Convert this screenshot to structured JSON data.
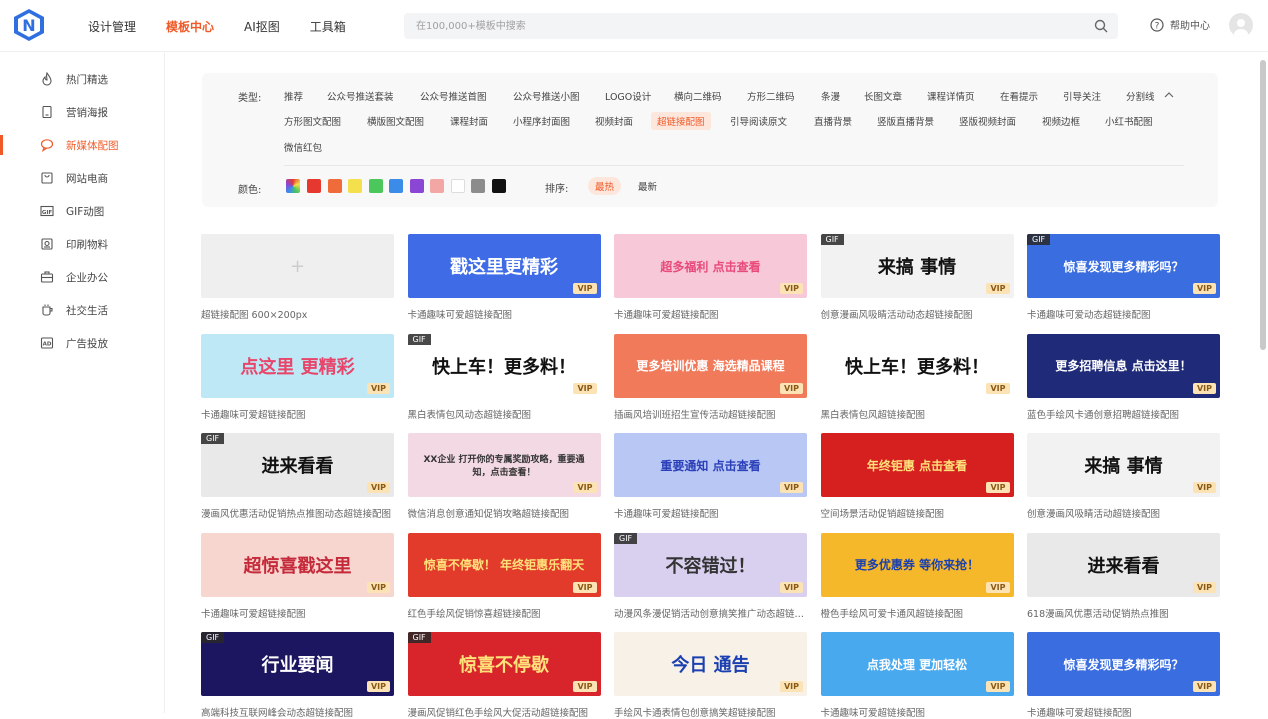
{
  "nav": {
    "items": [
      "设计管理",
      "模板中心",
      "AI抠图",
      "工具箱"
    ],
    "active_index": 1
  },
  "search": {
    "placeholder": "在100,000+模板中搜索"
  },
  "help": {
    "label": "帮助中心"
  },
  "sidebar": {
    "items": [
      {
        "label": "热门精选",
        "icon": "flame-icon"
      },
      {
        "label": "营销海报",
        "icon": "poster-icon"
      },
      {
        "label": "新媒体配图",
        "icon": "chat-icon"
      },
      {
        "label": "网站电商",
        "icon": "shop-icon"
      },
      {
        "label": "GIF动图",
        "icon": "gif-icon"
      },
      {
        "label": "印刷物料",
        "icon": "print-icon"
      },
      {
        "label": "企业办公",
        "icon": "briefcase-icon"
      },
      {
        "label": "社交生活",
        "icon": "cup-icon"
      },
      {
        "label": "广告投放",
        "icon": "ad-icon"
      }
    ],
    "active_index": 2
  },
  "filter": {
    "type_label": "类型:",
    "types_row1": [
      "推荐",
      "公众号推送套装",
      "公众号推送首图",
      "公众号推送小图",
      "LOGO设计",
      "横向二维码",
      "方形二维码",
      "条漫",
      "长图文章",
      "课程详情页",
      "在看提示",
      "引导关注",
      "分割线"
    ],
    "types_row2": [
      "方形图文配图",
      "横版图文配图",
      "课程封面",
      "小程序封面图",
      "视频封面",
      "超链接配图",
      "引导阅读原文",
      "直播背景",
      "竖版直播背景",
      "竖版视频封面",
      "视频边框",
      "小红书配图"
    ],
    "types_row3": [
      "微信红包"
    ],
    "active_type": "超链接配图",
    "color_label": "颜色:",
    "colors": [
      "#e6382f",
      "#ef6b39",
      "#f4e04d",
      "#4cc75b",
      "#3b8ce8",
      "#8b46d4",
      "#f2a7a4",
      "#ffffff",
      "#8c8c8c",
      "#111111"
    ],
    "sort_label": "排序:",
    "sort_options": [
      "最热",
      "最新"
    ],
    "active_sort": "最热"
  },
  "cards": [
    {
      "caption": "超链接配图 600×200px",
      "bg": "#efefef",
      "text": "",
      "fg": "#ccc",
      "gif": false,
      "vip": false,
      "plus": true
    },
    {
      "caption": "卡通趣味可爱超链接配图",
      "bg": "#3f6ce6",
      "text": "戳这里更精彩",
      "fg": "#fff",
      "gif": false,
      "vip": true
    },
    {
      "caption": "卡通趣味可爱超链接配图",
      "bg": "#f7c8d8",
      "text": "超多福利 点击查看",
      "fg": "#e84a7a",
      "gif": false,
      "vip": true
    },
    {
      "caption": "创意漫画风吸睛活动动态超链接配图",
      "bg": "#f2f2f2",
      "text": "来搞 事情",
      "fg": "#111",
      "gif": true,
      "vip": true
    },
    {
      "caption": "卡通趣味可爱动态超链接配图",
      "bg": "#3a6de0",
      "text": "惊喜发现更多精彩吗？",
      "fg": "#fff",
      "gif": true,
      "vip": true
    },
    {
      "caption": "卡通趣味可爱超链接配图",
      "bg": "#bfe8f7",
      "text": "点这里 更精彩",
      "fg": "#e8456a",
      "gif": false,
      "vip": true
    },
    {
      "caption": "黑白表情包风动态超链接配图",
      "bg": "#ffffff",
      "text": "快上车！更多料！",
      "fg": "#111",
      "gif": true,
      "vip": true
    },
    {
      "caption": "插画风培训班招生宣传活动超链接配图",
      "bg": "#f07a5a",
      "text": "更多培训优惠 海选精品课程",
      "fg": "#fff",
      "gif": false,
      "vip": true
    },
    {
      "caption": "黑白表情包风超链接配图",
      "bg": "#ffffff",
      "text": "快上车！更多料！",
      "fg": "#111",
      "gif": false,
      "vip": true
    },
    {
      "caption": "蓝色手绘风卡通创意招聘超链接配图",
      "bg": "#1f2a78",
      "text": "更多招聘信息 点击这里！",
      "fg": "#fff",
      "gif": false,
      "vip": true
    },
    {
      "caption": "漫画风优惠活动促销热点推图动态超链接配图",
      "bg": "#e9e9e9",
      "text": "进来看看",
      "fg": "#111",
      "gif": true,
      "vip": true
    },
    {
      "caption": "微信消息创意通知促销攻略超链接配图",
      "bg": "#f3d9e3",
      "text": "XX企业 打开你的专属奖励攻略，重要通知，点击查看！",
      "fg": "#333",
      "gif": false,
      "vip": true
    },
    {
      "caption": "卡通趣味可爱超链接配图",
      "bg": "#b9c7f5",
      "text": "重要通知 点击查看",
      "fg": "#2a3fb8",
      "gif": false,
      "vip": true
    },
    {
      "caption": "空间场景活动促销超链接配图",
      "bg": "#d61f1f",
      "text": "年终钜惠 点击查看",
      "fg": "#ffe27a",
      "gif": false,
      "vip": true
    },
    {
      "caption": "创意漫画风吸睛活动超链接配图",
      "bg": "#f2f2f2",
      "text": "来搞 事情",
      "fg": "#111",
      "gif": false,
      "vip": true
    },
    {
      "caption": "卡通趣味可爱超链接配图",
      "bg": "#f8d6d0",
      "text": "超惊喜戳这里",
      "fg": "#c42a3a",
      "gif": false,
      "vip": true
    },
    {
      "caption": "红色手绘风促销惊喜超链接配图",
      "bg": "#e23b2b",
      "text": "惊喜不停歇！ 年终钜惠乐翻天",
      "fg": "#ffe27a",
      "gif": false,
      "vip": true
    },
    {
      "caption": "动漫风条漫促销活动创意搞笑推广动态超链接配图",
      "bg": "#d9d0ef",
      "text": "不容错过！",
      "fg": "#333",
      "gif": true,
      "vip": true
    },
    {
      "caption": "橙色手绘风可爱卡通风超链接配图",
      "bg": "#f5b82a",
      "text": "更多优惠券 等你来抢！",
      "fg": "#1a3fb0",
      "gif": false,
      "vip": true
    },
    {
      "caption": "618漫画风优惠活动促销热点推图",
      "bg": "#e9e9e9",
      "text": "进来看看",
      "fg": "#111",
      "gif": false,
      "vip": true
    },
    {
      "caption": "高端科技互联网峰会动态超链接配图",
      "bg": "#1c1560",
      "text": "行业要闻",
      "fg": "#fff",
      "gif": true,
      "vip": true
    },
    {
      "caption": "漫画风促销红色手绘风大促活动超链接配图",
      "bg": "#d8252c",
      "text": "惊喜不停歇",
      "fg": "#ffe27a",
      "gif": true,
      "vip": true
    },
    {
      "caption": "手绘风卡通表情包创意搞笑超链接配图",
      "bg": "#f7f1e8",
      "text": "今日 通告",
      "fg": "#1a3fb0",
      "gif": false,
      "vip": true
    },
    {
      "caption": "卡通趣味可爱超链接配图",
      "bg": "#49a9ef",
      "text": "点我处理 更加轻松",
      "fg": "#fff",
      "gif": false,
      "vip": true
    },
    {
      "caption": "卡通趣味可爱超链接配图",
      "bg": "#3a6de0",
      "text": "惊喜发现更多精彩吗？",
      "fg": "#fff",
      "gif": false,
      "vip": true
    }
  ],
  "badges": {
    "vip": "VIP",
    "gif": "GIF"
  }
}
